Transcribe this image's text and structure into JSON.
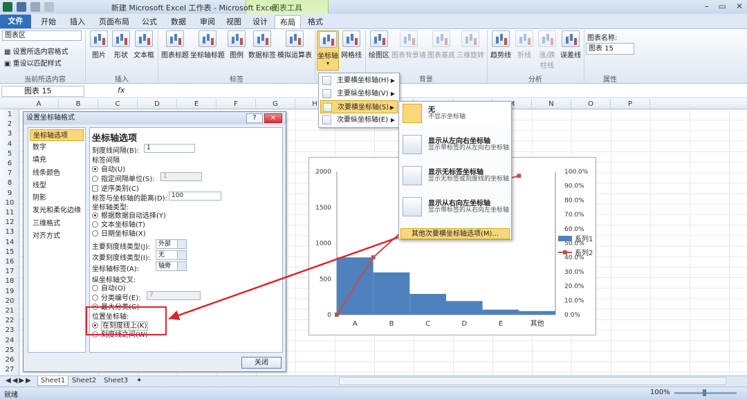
{
  "app": {
    "window_title": "新建 Microsoft Excel 工作表 - Microsoft Excel",
    "context_tab_label": "图表工具",
    "ribbon_tabs": [
      "文件",
      "开始",
      "插入",
      "页面布局",
      "公式",
      "数据",
      "审阅",
      "视图",
      "设计",
      "布局",
      "格式"
    ]
  },
  "ribbon": {
    "current_selection": {
      "dropdown_value": "图表区",
      "format_selection": "设置所选内容格式",
      "reset_style": "重设以匹配样式",
      "group_label": "当前所选内容"
    },
    "insert_group": {
      "label": "插入",
      "buttons": [
        "图片",
        "形状",
        "文本框"
      ]
    },
    "labels_group": {
      "label": "标签",
      "buttons": [
        "图表标题",
        "坐标轴标题",
        "图例",
        "数据标签",
        "模拟运算表"
      ]
    },
    "axes_group": {
      "buttons": [
        "坐标轴",
        "网格线"
      ]
    },
    "background_group": {
      "label": "背景",
      "buttons": [
        "绘图区",
        "图表背景墙",
        "图表基底",
        "三维旋转"
      ]
    },
    "analysis_group": {
      "label": "分析",
      "buttons": [
        "趋势线",
        "折线",
        "涨/跌柱线",
        "误差线"
      ]
    },
    "properties_group": {
      "label": "属性",
      "chart_name_label": "图表名称:",
      "chart_name_value": "图表 15"
    }
  },
  "formula_bar": {
    "name_box": "图表 15",
    "fx": "fx"
  },
  "columns": [
    "A",
    "B",
    "C",
    "D",
    "E",
    "F",
    "G",
    "H",
    "I",
    "J",
    "K",
    "L",
    "M",
    "N",
    "O",
    "P"
  ],
  "rows": [
    "1",
    "2",
    "3",
    "4",
    "5",
    "6",
    "7",
    "8",
    "9",
    "10",
    "11",
    "12",
    "13",
    "14",
    "15",
    "16",
    "17",
    "18",
    "19",
    "20",
    "21",
    "22",
    "23",
    "24",
    "25",
    "26",
    "27"
  ],
  "dialog": {
    "title": "设置坐标轴格式",
    "help_button": "?",
    "close_x": "×",
    "nav_items": [
      "坐标轴选项",
      "数字",
      "填充",
      "线条颜色",
      "线型",
      "阴影",
      "发光和柔化边缘",
      "三维格式",
      "对齐方式"
    ],
    "section_title": "坐标轴选项",
    "tick_interval_label": "刻度线间隔(B):",
    "tick_interval_value": "1",
    "label_interval_label": "标签间隔",
    "auto_label": "自动(U)",
    "specify_interval_label": "指定间隔单位(S):",
    "specify_interval_value": "1",
    "reverse_label": "逆序类别(C)",
    "label_distance_label": "标签与坐标轴的距离(D):",
    "label_distance_value": "100",
    "axis_type_label": "坐标轴类型:",
    "axis_type_auto": "根据数据自动选择(Y)",
    "axis_type_text": "文本坐标轴(T)",
    "axis_type_date": "日期坐标轴(X)",
    "major_tick_label": "主要刻度线类型(J):",
    "major_tick_value": "外部",
    "minor_tick_label": "次要刻度线类型(I):",
    "minor_tick_value": "无",
    "axis_label_label": "坐标轴标签(A):",
    "axis_label_value": "轴旁",
    "cross_label": "纵坐标轴交叉:",
    "cross_auto": "自动(O)",
    "cross_category": "分类编号(E):",
    "cross_category_value": "7",
    "cross_max": "最大分类(G)",
    "position_label": "位置坐标轴:",
    "position_on_tick": "在刻度线上(K)",
    "position_between": "刻度线之间(W)",
    "close_button": "关闭"
  },
  "axis_menu": {
    "items": [
      "主要横坐标轴(H)",
      "主要纵坐标轴(V)",
      "次要横坐标轴(S)",
      "次要纵坐标轴(E)"
    ],
    "sub_items": [
      {
        "title": "无",
        "desc": "不显示坐标轴"
      },
      {
        "title": "显示从左向右坐标轴",
        "desc": "显示带标签的从左向右坐标轴"
      },
      {
        "title": "显示无标签坐标轴",
        "desc": "显示无标签或刻度线的坐标轴"
      },
      {
        "title": "显示从右向左坐标轴",
        "desc": "显示带标签的从右向左坐标轴"
      }
    ],
    "more_options": "其他次要横坐标轴选项(M)..."
  },
  "chart_data": {
    "type": "bar",
    "categories": [
      "A",
      "B",
      "C",
      "D",
      "E",
      "其他"
    ],
    "series": [
      {
        "name": "系列1",
        "type": "bar",
        "values": [
          800,
          590,
          290,
          190,
          70,
          50
        ]
      },
      {
        "name": "系列2",
        "type": "line",
        "axis": "secondary",
        "values": [
          0,
          0.4,
          0.63,
          0.79,
          0.9,
          0.97
        ]
      }
    ],
    "y_ticks": [
      "0",
      "500",
      "1000",
      "1500",
      "2000"
    ],
    "ylim": [
      0,
      2000
    ],
    "y2_ticks": [
      "0.0%",
      "10.0%",
      "20.0%",
      "30.0%",
      "40.0%",
      "50.0%",
      "60.0%",
      "70.0%",
      "80.0%",
      "90.0%",
      "100.0%"
    ],
    "y2lim": [
      0,
      1
    ],
    "legend_placement": "right",
    "colors": {
      "bar": "#4f81bd",
      "line": "#c0504d"
    }
  },
  "sheets": [
    "Sheet1",
    "Sheet2",
    "Sheet3"
  ],
  "status": {
    "ready": "就绪",
    "zoom": "100%"
  }
}
